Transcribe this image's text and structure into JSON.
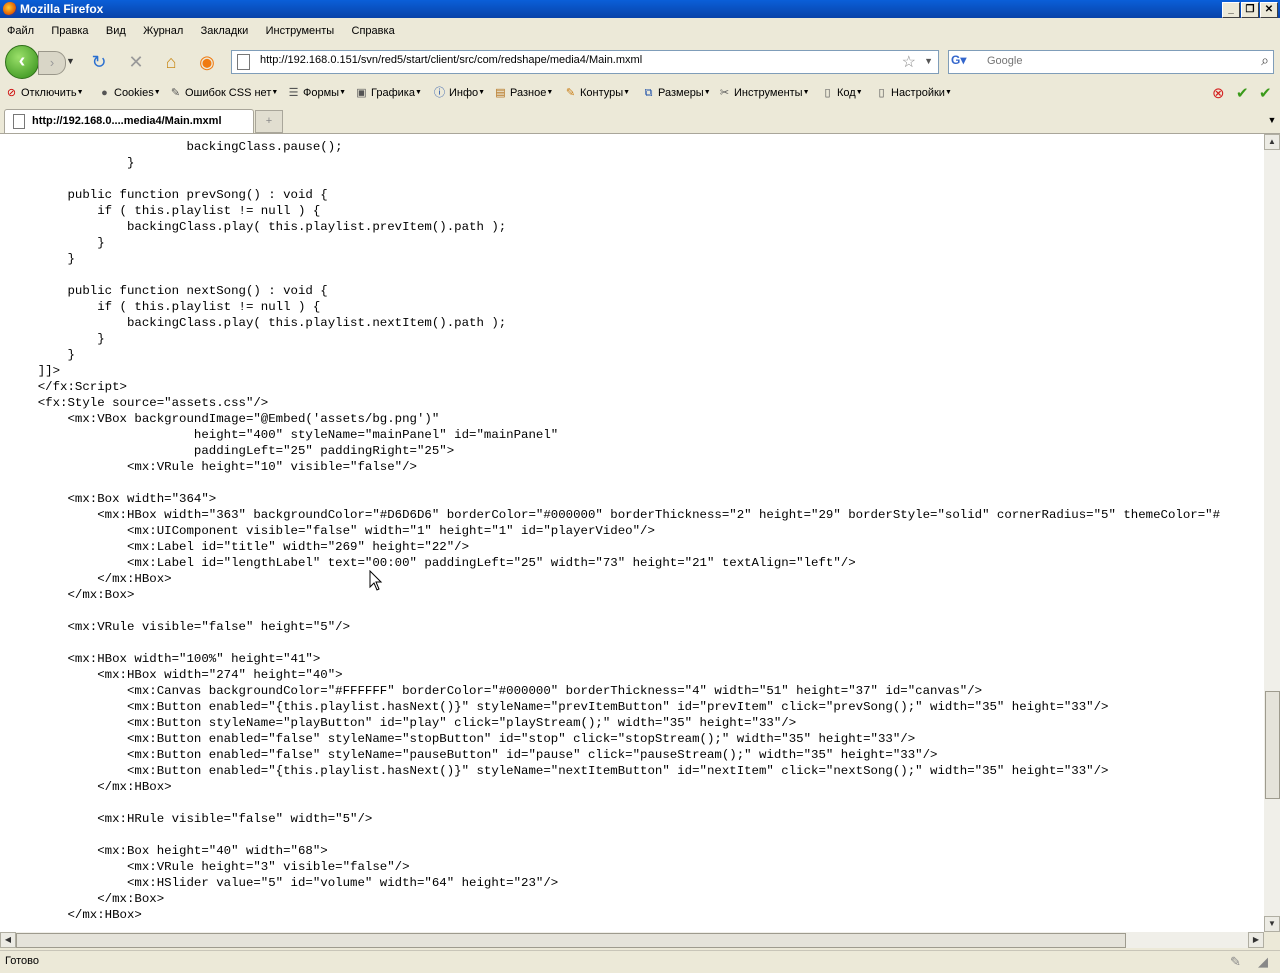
{
  "window": {
    "title": "Mozilla Firefox"
  },
  "menu": [
    "Файл",
    "Правка",
    "Вид",
    "Журнал",
    "Закладки",
    "Инструменты",
    "Справка"
  ],
  "nav": {
    "url": "http://192.168.0.151/svn/red5/start/client/src/com/redshape/media4/Main.mxml",
    "search_placeholder": "Google"
  },
  "devtoolbar": [
    {
      "label": "Отключить",
      "icon": "disable-icon"
    },
    {
      "label": "Cookies",
      "icon": "cookie-icon"
    },
    {
      "label": "Ошибок CSS нет",
      "icon": "css-icon"
    },
    {
      "label": "Формы",
      "icon": "forms-icon"
    },
    {
      "label": "Графика",
      "icon": "image-icon"
    },
    {
      "label": "Инфо",
      "icon": "info-icon"
    },
    {
      "label": "Разное",
      "icon": "misc-icon"
    },
    {
      "label": "Контуры",
      "icon": "outline-icon"
    },
    {
      "label": "Размеры",
      "icon": "resize-icon"
    },
    {
      "label": "Инструменты",
      "icon": "tools-icon"
    },
    {
      "label": "Код",
      "icon": "source-icon"
    },
    {
      "label": "Настройки",
      "icon": "options-icon"
    }
  ],
  "tab": {
    "title": "http://192.168.0....media4/Main.mxml"
  },
  "code_lines": [
    "                        backingClass.pause();",
    "                }",
    "",
    "        public function prevSong() : void {",
    "            if ( this.playlist != null ) {",
    "                backingClass.play( this.playlist.prevItem().path );",
    "            }",
    "        }",
    "",
    "        public function nextSong() : void {",
    "            if ( this.playlist != null ) {",
    "                backingClass.play( this.playlist.nextItem().path );",
    "            }",
    "        }",
    "    ]]>",
    "    </fx:Script>",
    "    <fx:Style source=\"assets.css\"/>",
    "        <mx:VBox backgroundImage=\"@Embed('assets/bg.png')\"",
    "                         height=\"400\" styleName=\"mainPanel\" id=\"mainPanel\"",
    "                         paddingLeft=\"25\" paddingRight=\"25\">",
    "                <mx:VRule height=\"10\" visible=\"false\"/>",
    "",
    "        <mx:Box width=\"364\">",
    "            <mx:HBox width=\"363\" backgroundColor=\"#D6D6D6\" borderColor=\"#000000\" borderThickness=\"2\" height=\"29\" borderStyle=\"solid\" cornerRadius=\"5\" themeColor=\"#",
    "                <mx:UIComponent visible=\"false\" width=\"1\" height=\"1\" id=\"playerVideo\"/>",
    "                <mx:Label id=\"title\" width=\"269\" height=\"22\"/>",
    "                <mx:Label id=\"lengthLabel\" text=\"00:00\" paddingLeft=\"25\" width=\"73\" height=\"21\" textAlign=\"left\"/>",
    "            </mx:HBox>",
    "        </mx:Box>",
    "",
    "        <mx:VRule visible=\"false\" height=\"5\"/>",
    "",
    "        <mx:HBox width=\"100%\" height=\"41\">",
    "            <mx:HBox width=\"274\" height=\"40\">",
    "                <mx:Canvas backgroundColor=\"#FFFFFF\" borderColor=\"#000000\" borderThickness=\"4\" width=\"51\" height=\"37\" id=\"canvas\"/>",
    "                <mx:Button enabled=\"{this.playlist.hasNext()}\" styleName=\"prevItemButton\" id=\"prevItem\" click=\"prevSong();\" width=\"35\" height=\"33\"/>",
    "                <mx:Button styleName=\"playButton\" id=\"play\" click=\"playStream();\" width=\"35\" height=\"33\"/>",
    "                <mx:Button enabled=\"false\" styleName=\"stopButton\" id=\"stop\" click=\"stopStream();\" width=\"35\" height=\"33\"/>",
    "                <mx:Button enabled=\"false\" styleName=\"pauseButton\" id=\"pause\" click=\"pauseStream();\" width=\"35\" height=\"33\"/>",
    "                <mx:Button enabled=\"{this.playlist.hasNext()}\" styleName=\"nextItemButton\" id=\"nextItem\" click=\"nextSong();\" width=\"35\" height=\"33\"/>",
    "            </mx:HBox>",
    "",
    "            <mx:HRule visible=\"false\" width=\"5\"/>",
    "",
    "            <mx:Box height=\"40\" width=\"68\">",
    "                <mx:VRule height=\"3\" visible=\"false\"/>",
    "                <mx:HSlider value=\"5\" id=\"volume\" width=\"64\" height=\"23\"/>",
    "            </mx:Box>",
    "        </mx:HBox>"
  ],
  "status": {
    "text": "Готово"
  },
  "scroll": {
    "vertical_position": 0.82,
    "horizontal_position": 0.0
  }
}
